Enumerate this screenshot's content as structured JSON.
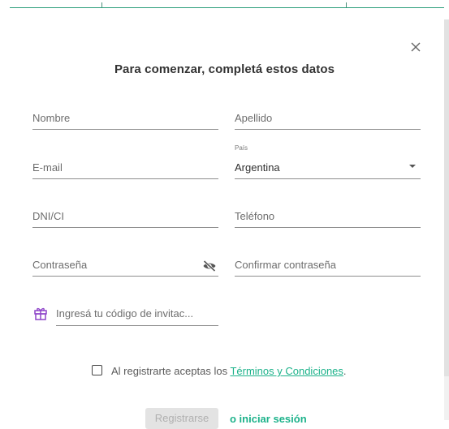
{
  "modal": {
    "title": "Para comenzar, completá estos datos",
    "close_icon": "close-icon"
  },
  "form": {
    "nombre": {
      "label": "Nombre"
    },
    "apellido": {
      "label": "Apellido"
    },
    "email": {
      "label": "E-mail"
    },
    "pais": {
      "label": "País",
      "value": "Argentina",
      "icon": "chevron-down-icon"
    },
    "dni": {
      "label": "DNI/CI"
    },
    "telefono": {
      "label": "Teléfono"
    },
    "password": {
      "label": "Contraseña",
      "icon": "eye-off-icon"
    },
    "confirm_password": {
      "label": "Confirmar contraseña"
    },
    "invite": {
      "placeholder": "Ingresá tu código de invitac...",
      "icon": "gift-icon"
    }
  },
  "terms": {
    "prefix": "Al registrarte aceptas los ",
    "link": "Términos y Condiciones",
    "suffix": ".",
    "checked": false
  },
  "actions": {
    "register_label": "Registrarse",
    "login_link": "o iniciar sesión"
  },
  "colors": {
    "accent": "#1cb28a",
    "gift_icon": "#8e44c9",
    "underline": "#8e8e8e",
    "disabled_button": "#e3e3e3"
  }
}
